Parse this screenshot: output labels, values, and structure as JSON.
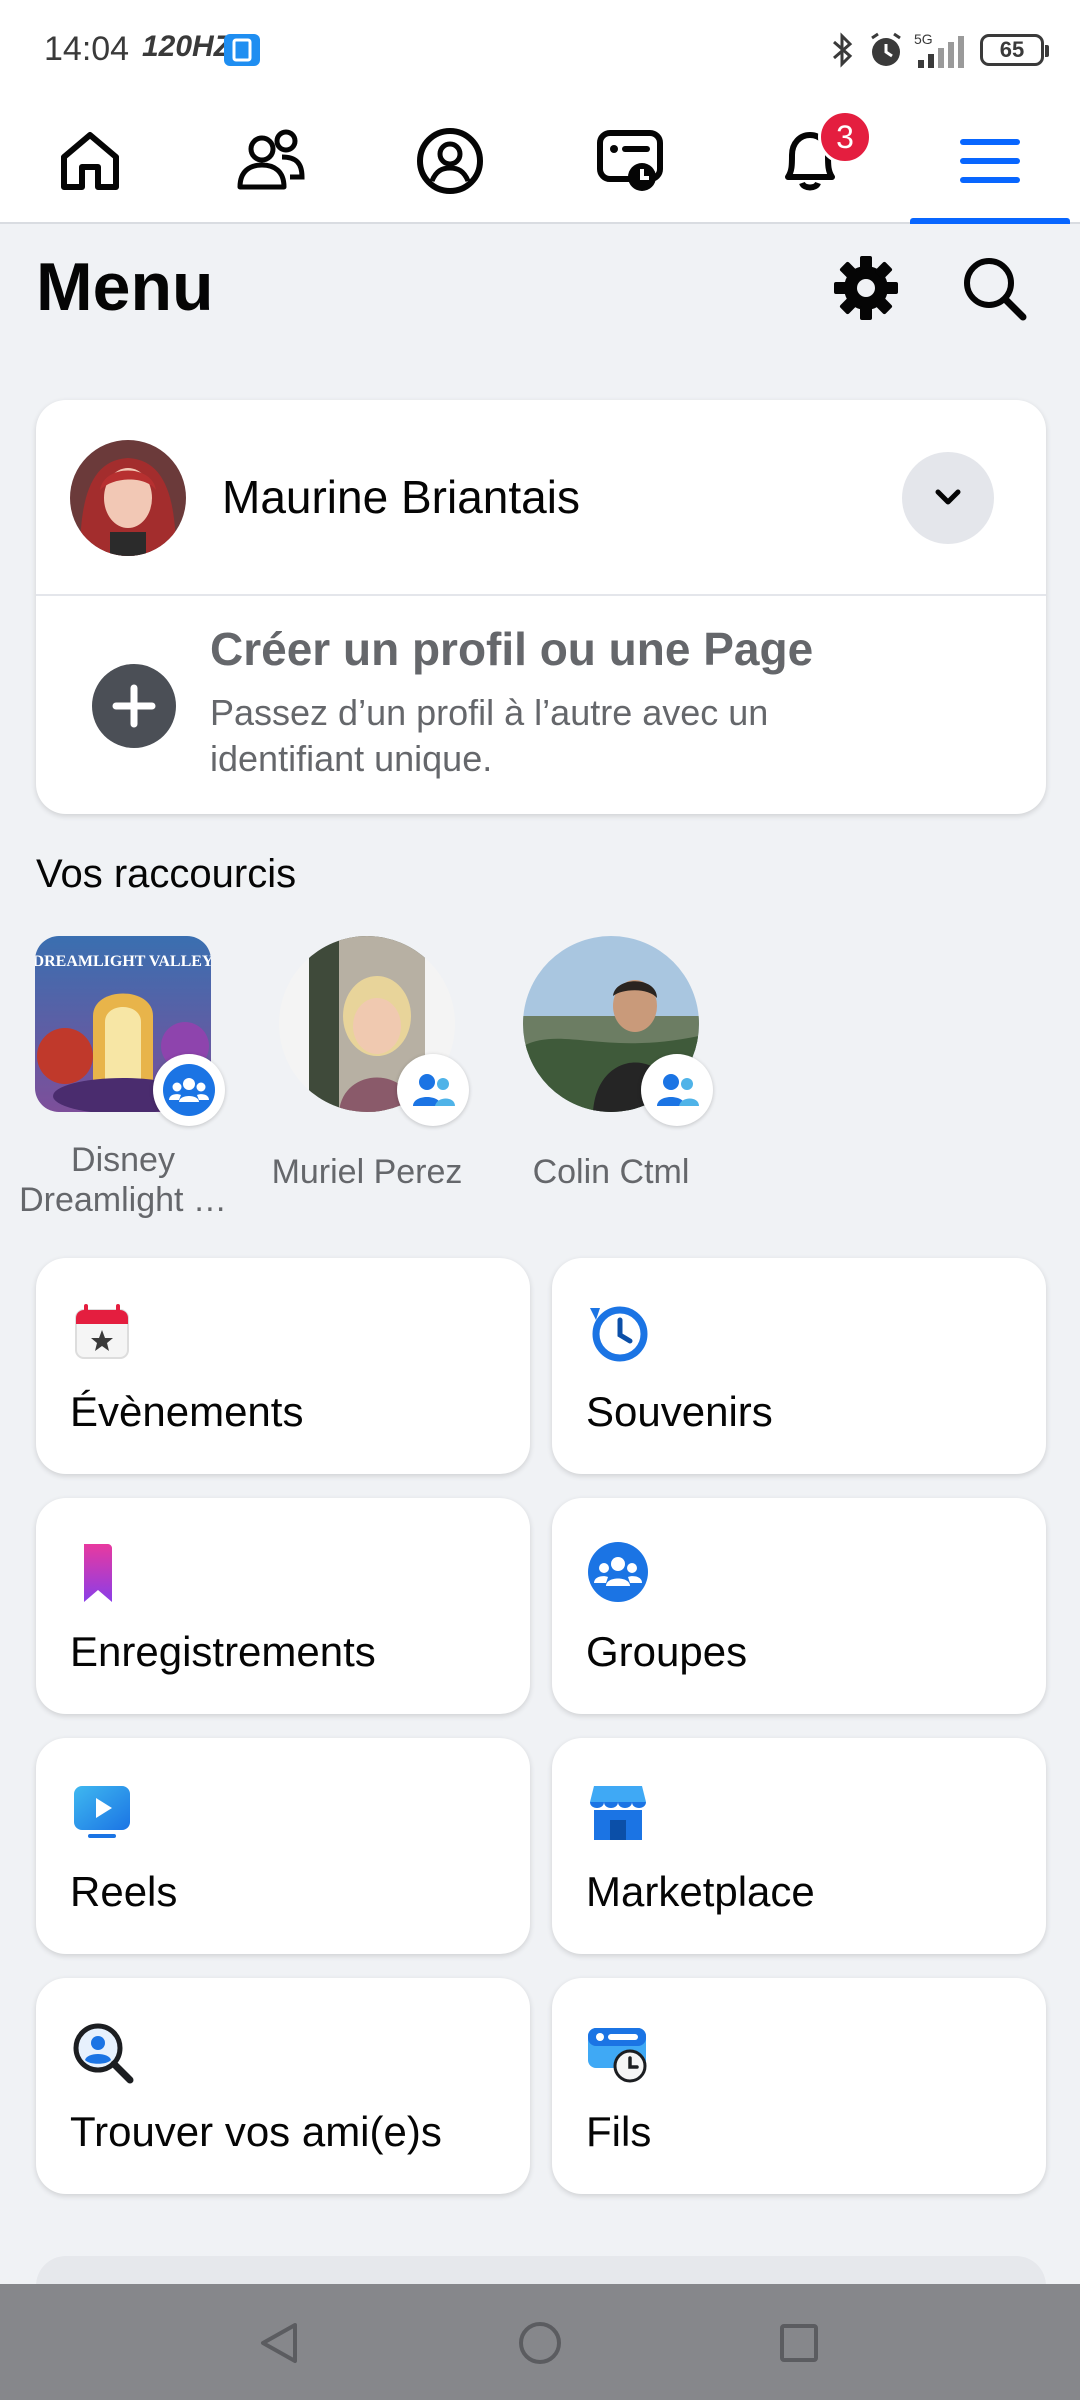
{
  "status_bar": {
    "time": "14:04",
    "refresh_rate": "120HZ",
    "battery": "65",
    "network": "5G"
  },
  "nav": {
    "items": [
      {
        "name": "home"
      },
      {
        "name": "friends"
      },
      {
        "name": "profile"
      },
      {
        "name": "feeds"
      },
      {
        "name": "notifications",
        "badge": "3"
      },
      {
        "name": "menu",
        "active": true
      }
    ]
  },
  "header": {
    "title": "Menu"
  },
  "profile": {
    "name": "Maurine Briantais",
    "create_title": "Créer un profil ou une Page",
    "create_subtitle": "Passez d’un profil à l’autre avec un identifiant unique."
  },
  "shortcuts": {
    "title": "Vos raccourcis",
    "items": [
      {
        "label": "Disney Dreamlight …",
        "type": "group",
        "image_text": "DREAMLIGHT VALLEY"
      },
      {
        "label": "Muriel Perez",
        "type": "friend"
      },
      {
        "label": "Colin Ctml",
        "type": "friend"
      }
    ]
  },
  "tiles": [
    {
      "label": "Évènements",
      "icon": "calendar-star-icon"
    },
    {
      "label": "Souvenirs",
      "icon": "memories-clock-icon"
    },
    {
      "label": "Enregistrements",
      "icon": "bookmark-icon"
    },
    {
      "label": "Groupes",
      "icon": "groups-icon"
    },
    {
      "label": "Reels",
      "icon": "reels-play-icon"
    },
    {
      "label": "Marketplace",
      "icon": "marketplace-store-icon"
    },
    {
      "label": "Trouver vos ami(e)s",
      "icon": "find-friends-icon"
    },
    {
      "label": "Fils",
      "icon": "feeds-icon"
    }
  ],
  "colors": {
    "accent": "#0866ff",
    "badge": "#e41e3f",
    "background": "#f0f2f5"
  }
}
